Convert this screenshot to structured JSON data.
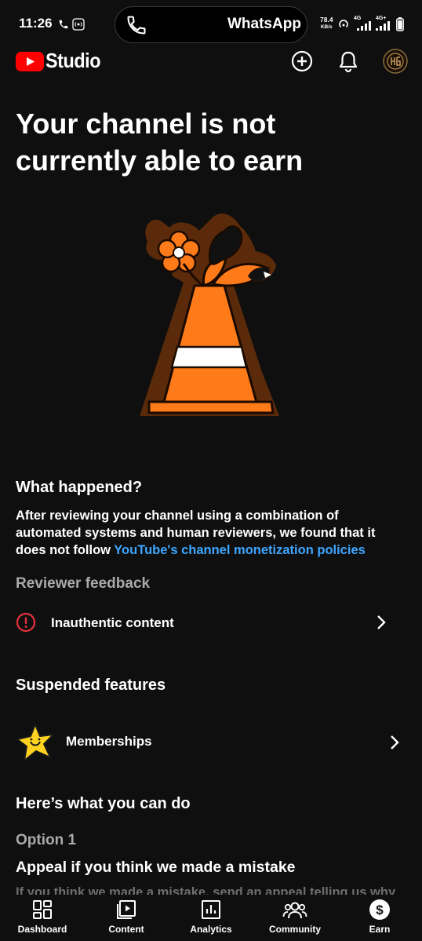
{
  "status_bar": {
    "time": "11:26",
    "active_call_app": "WhatsApp",
    "net_speed_value": "78.4",
    "net_speed_unit": "KB/s",
    "signal_1": "4G",
    "signal_2": "4G+"
  },
  "app_bar": {
    "brand": "Studio"
  },
  "headline": "Your channel is not currently able to earn",
  "what_happened": {
    "title": "What happened?",
    "body": "After reviewing your channel using a combination of automated systems and human reviewers, we found that it does not follow ",
    "link_text": "YouTube's channel monetization policies"
  },
  "reviewer_feedback": {
    "title": "Reviewer feedback",
    "item_label": "Inauthentic content"
  },
  "suspended_features": {
    "title": "Suspended features",
    "item_label": "Memberships"
  },
  "what_you_can_do": {
    "title": "Here’s what you can do",
    "option_label": "Option 1",
    "option_title": "Appeal if you think we made a mistake",
    "option_body_partial": "If you think we made a mistake, send an appeal telling us why"
  },
  "bottom_nav": [
    {
      "label": "Dashboard",
      "icon": "dashboard-icon"
    },
    {
      "label": "Content",
      "icon": "content-icon"
    },
    {
      "label": "Analytics",
      "icon": "analytics-icon"
    },
    {
      "label": "Community",
      "icon": "community-icon"
    },
    {
      "label": "Earn",
      "icon": "earn-icon",
      "active": true
    }
  ],
  "colors": {
    "background": "#0f0f0f",
    "link": "#3ea6ff",
    "brand_red": "#ff0000",
    "alert_red": "#e5323c",
    "muted_text": "#aaaaaa"
  }
}
